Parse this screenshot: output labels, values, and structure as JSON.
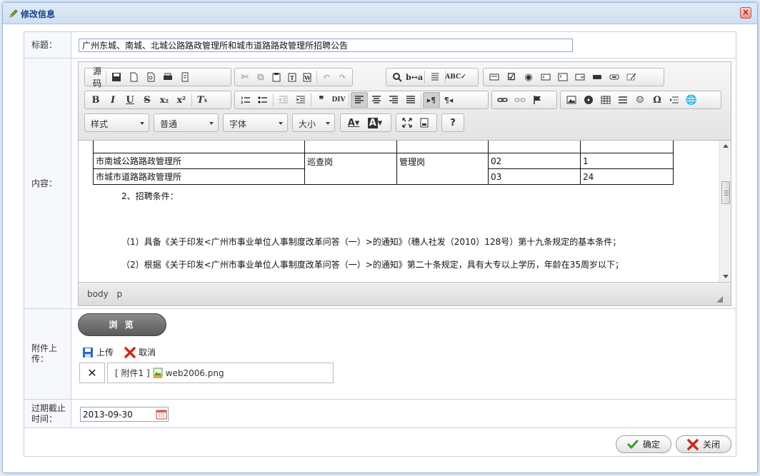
{
  "window": {
    "title": "修改信息"
  },
  "form": {
    "title_label": "标题：",
    "title_value": "广州东城、南城、北城公路路政管理所和城市道路路政管理所招聘公告",
    "content_label": "内容：",
    "attachment_label": "附件上传：",
    "expiry_label": "过期截止时间：",
    "expiry_value": "2013-09-30"
  },
  "editor": {
    "source_label": "源码",
    "combos": {
      "style": "样式",
      "format": "普通",
      "font": "字体",
      "size": "大小"
    },
    "table_rows": [
      [
        "市南城公路路政管理所",
        "巡查岗",
        "管理岗",
        "02",
        "1"
      ],
      [
        "市城市道路路政管理所",
        "",
        "",
        "03",
        "24"
      ]
    ],
    "paragraphs": [
      "2、招聘条件：",
      "（1）具备《关于印发<广州市事业单位人事制度改革问答（一）>的通知》（穗人社发（2010）128号）第十九条规定的基本条件；",
      "（2）根据《关于印发<广州市事业单位人事制度改革问答（一）>的通知》第二十条规定，具有大专以上学历，年龄在35周岁以下；"
    ],
    "status_path": [
      "body",
      "p"
    ]
  },
  "attachment": {
    "browse_label": "浏 览",
    "upload_label": "上传",
    "cancel_label": "取消",
    "file_prefix": "[ 附件1 ]",
    "file_name": "web2006.png"
  },
  "actions": {
    "confirm_label": "确定",
    "close_label": "关闭"
  },
  "colors": {
    "title_text": "#15428b",
    "border": "#99bbe8",
    "confirm_check": "#3a9a2a",
    "close_x": "#d0281e"
  }
}
